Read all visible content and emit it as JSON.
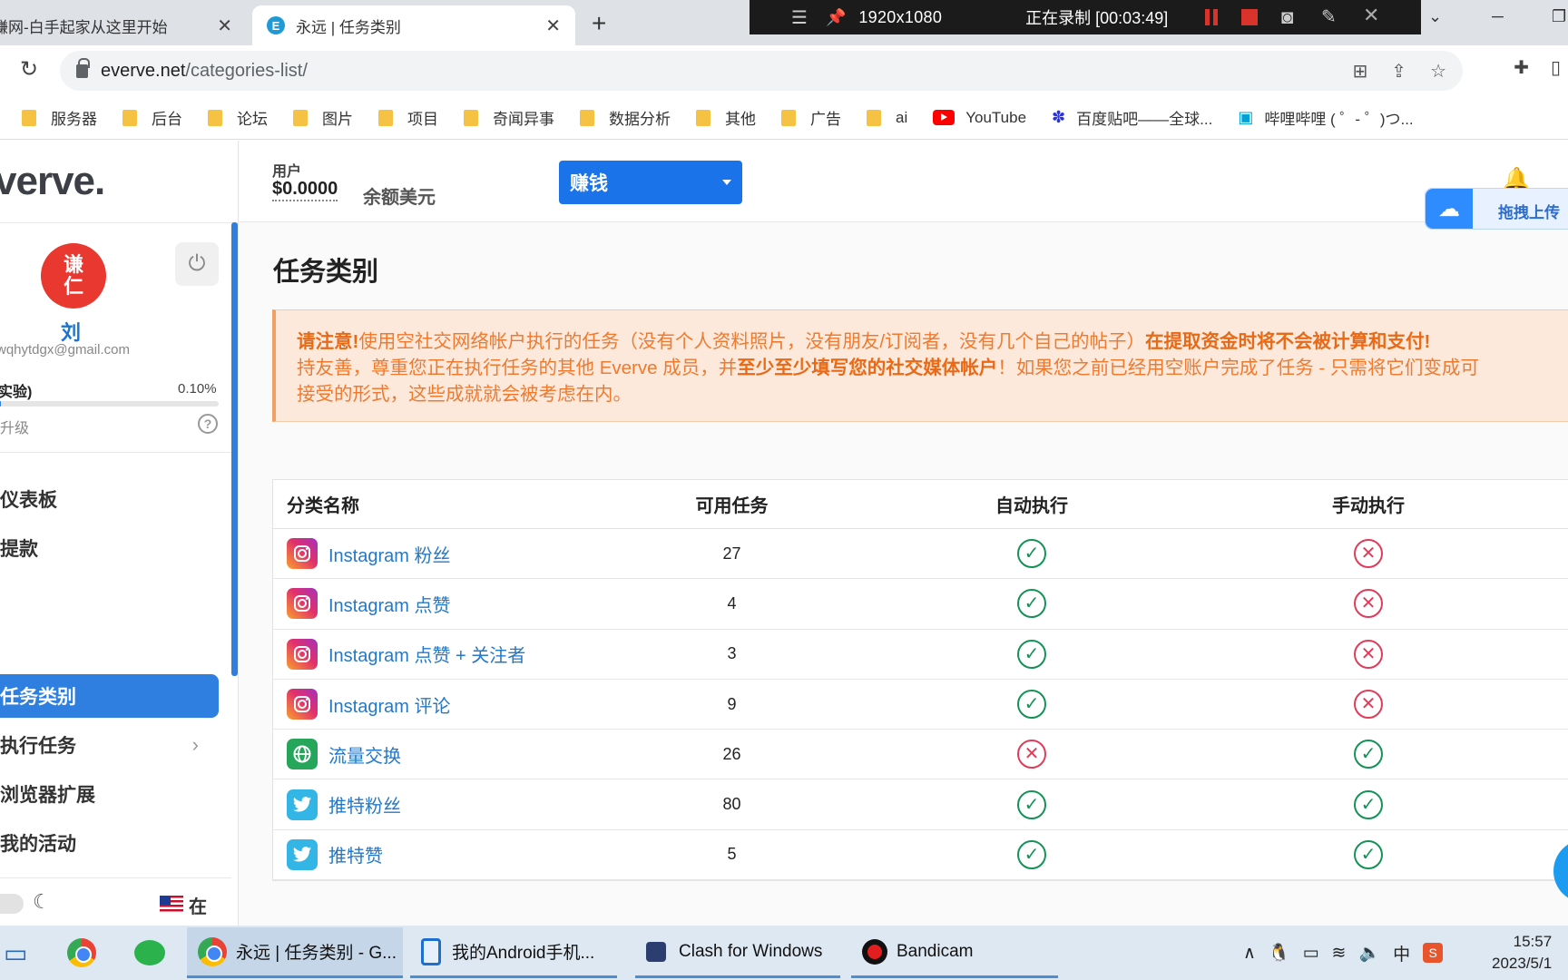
{
  "browser": {
    "tabs": [
      {
        "title": "赚网-白手起家从这里开始",
        "active": false
      },
      {
        "title": "永远 | 任务类别",
        "active": true
      }
    ],
    "active_tab_favicon": "E",
    "url_host": "everve.net",
    "url_path": "/categories-list/",
    "bookmarks": [
      "服务器",
      "后台",
      "论坛",
      "图片",
      "项目",
      "奇闻异事",
      "数据分析",
      "其他",
      "广告",
      "ai"
    ],
    "bookmarks_special": {
      "youtube": "YouTube",
      "baidu": "百度贴吧——全球...",
      "bilibili": "哔哩哔哩 ( ゜- ゜)つ..."
    }
  },
  "recorder": {
    "resolution": "1920x1080",
    "status": "正在录制 [00:03:49]"
  },
  "sidebar": {
    "logo": "verve.",
    "avatar_text_1": "谦",
    "avatar_text_2": "仁",
    "user_name": "刘",
    "user_email": "wqhytdgx@gmail.com",
    "level_label": "实验)",
    "level_percent": "0.10%",
    "level_progress": 0.001,
    "upgrade_label": "升级",
    "nav": [
      {
        "label": "仪表板",
        "active": false
      },
      {
        "label": "提款",
        "active": false
      },
      {
        "label": "任务类别",
        "active": true
      },
      {
        "label": "执行任务",
        "active": false
      },
      {
        "label": "浏览器扩展",
        "active": false
      },
      {
        "label": "我的活动",
        "active": false
      }
    ],
    "lang_label": "在"
  },
  "header": {
    "balance_label": "用户",
    "balance_value": "$0.0000",
    "balance_unit": "余额美元",
    "earn_button": "赚钱",
    "upload_widget": "拖拽上传"
  },
  "main": {
    "title": "任务类别",
    "notice": {
      "line1_bold": "请注意!",
      "line1_text": "使用空社交网络帐户执行的任务（没有个人资料照片，没有朋友/订阅者，没有几个自己的帖子）",
      "line1_bold2": "在提取资金时将不会被计算和支付!",
      "line2_text": "持友善，尊重您正在执行任务的其他 Everve 成员，并",
      "line2_bold": "至少至少填写您的社交媒体帐户",
      "line2_text2": "！如果您之前已经用空账户完成了任务 - 只需将它们变成可",
      "line3_text": "接受的形式，这些成就就会被考虑在内。"
    },
    "table": {
      "headers": [
        "分类名称",
        "可用任务",
        "自动执行",
        "手动执行"
      ],
      "rows": [
        {
          "icon": "instagram-icon",
          "name": "Instagram 粉丝",
          "count": "27",
          "auto": true,
          "manual": false
        },
        {
          "icon": "instagram-icon",
          "name": "Instagram 点赞",
          "count": "4",
          "auto": true,
          "manual": false
        },
        {
          "icon": "instagram-icon",
          "name": "Instagram 点赞 + 关注者",
          "count": "3",
          "auto": true,
          "manual": false
        },
        {
          "icon": "instagram-icon",
          "name": "Instagram 评论",
          "count": "9",
          "auto": true,
          "manual": false
        },
        {
          "icon": "globe-icon",
          "name": "流量交换",
          "count": "26",
          "auto": false,
          "manual": true
        },
        {
          "icon": "twitter-icon",
          "name": "推特粉丝",
          "count": "80",
          "auto": true,
          "manual": true
        },
        {
          "icon": "twitter-icon",
          "name": "推特赞",
          "count": "5",
          "auto": true,
          "manual": true
        }
      ]
    }
  },
  "taskbar": {
    "items": [
      {
        "label": "永远 | 任务类别 - G...",
        "icon": "chrome-icon",
        "state": "active"
      },
      {
        "label": "我的Android手机...",
        "icon": "phone-icon",
        "state": "open"
      },
      {
        "label": "Clash for Windows",
        "icon": "clash-icon",
        "state": "open"
      },
      {
        "label": "Bandicam",
        "icon": "bandicam-icon",
        "state": "open"
      }
    ],
    "ime": "中",
    "time": "15:57",
    "date": "2023/5/1"
  }
}
